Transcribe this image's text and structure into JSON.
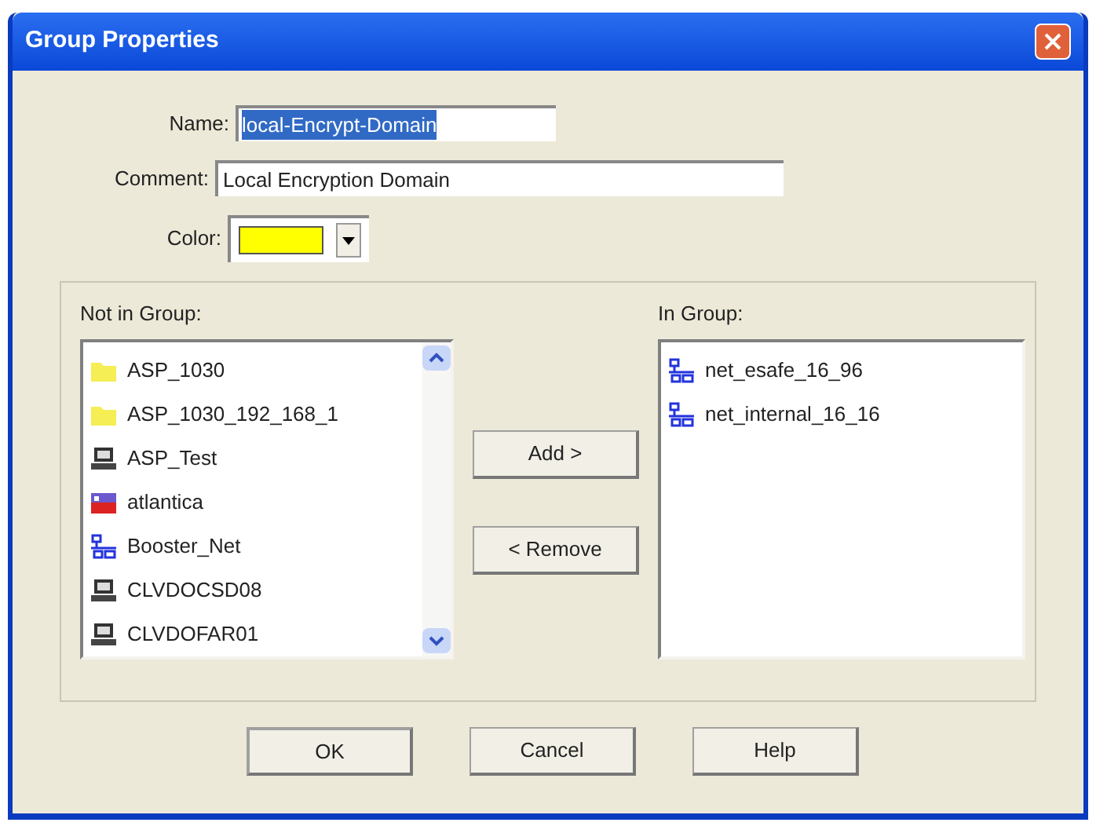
{
  "window": {
    "title": "Group Properties"
  },
  "fields": {
    "name": {
      "label": "Name:",
      "value": "local-Encrypt-Domain",
      "text_selected": true
    },
    "comment": {
      "label": "Comment:",
      "value": "Local Encryption Domain"
    },
    "color": {
      "label": "Color:",
      "color": "#ffff00"
    }
  },
  "not_in_group": {
    "label": "Not in Group:",
    "items": [
      {
        "name": "ASP_1030",
        "kind": "folder"
      },
      {
        "name": "ASP_1030_192_168_1",
        "kind": "folder"
      },
      {
        "name": "ASP_Test",
        "kind": "host"
      },
      {
        "name": "atlantica",
        "kind": "gateway"
      },
      {
        "name": "Booster_Net",
        "kind": "network"
      },
      {
        "name": "CLVDOCSD08",
        "kind": "host"
      },
      {
        "name": "CLVDOFAR01",
        "kind": "host"
      }
    ]
  },
  "move_buttons": [
    "Add >",
    "< Remove"
  ],
  "in_group": {
    "label": "In Group:",
    "items": [
      {
        "name": "net_esafe_16_96",
        "kind": "network"
      },
      {
        "name": "net_internal_16_16",
        "kind": "network"
      }
    ]
  },
  "buttons": [
    {
      "label": "OK",
      "default": true
    },
    {
      "label": "Cancel",
      "default": false
    },
    {
      "label": "Help",
      "default": false
    }
  ]
}
